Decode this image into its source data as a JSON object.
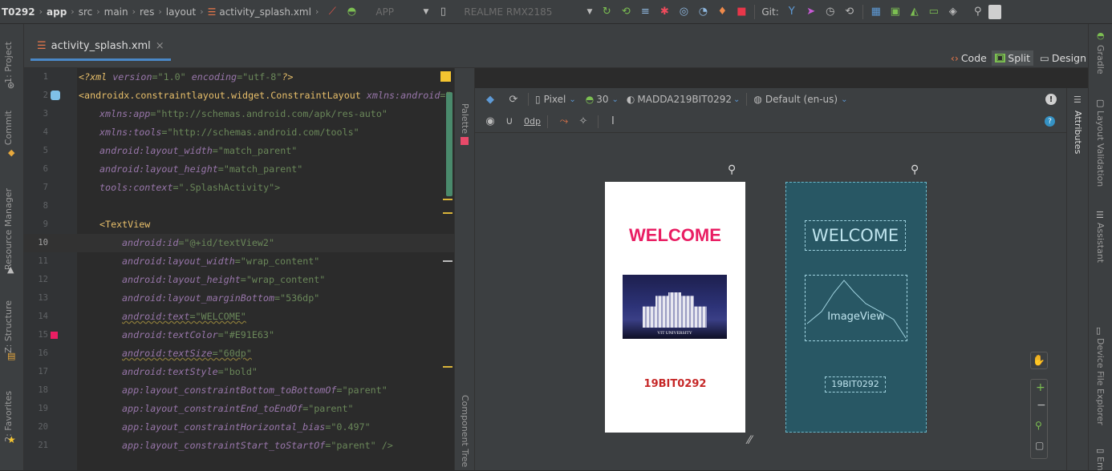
{
  "navbar": {
    "crumbs": [
      "T0292",
      "app",
      "src",
      "main",
      "res",
      "layout",
      "activity_splash.xml"
    ],
    "run_config": "APP",
    "device": "REALME RMX2185",
    "git_label": "Git:"
  },
  "left_tools": [
    "1: Project",
    "Commit",
    "Resource Manager",
    "Z: Structure",
    "2: Favorites"
  ],
  "right_tools": [
    "Gradle",
    "Layout Validation",
    "Assistant",
    "Device File Explorer",
    "Em"
  ],
  "tab": {
    "label": "activity_splash.xml",
    "close": "×"
  },
  "view_modes": {
    "code": "Code",
    "split": "Split",
    "design": "Design"
  },
  "palette_label": "Palette",
  "component_tree_label": "Component Tree",
  "attributes_label": "Attributes",
  "design_toolbar": {
    "device": "Pixel",
    "api": "30",
    "theme": "MADDA219BIT0292",
    "locale": "Default (en-us)",
    "margin": "0dp"
  },
  "preview": {
    "welcome": "WELCOME",
    "image_caption": "VIT UNIVERSITY",
    "reg_no": "19BIT0292",
    "welcome_color": "#E91E63",
    "reg_color": "#C62828"
  },
  "blueprint": {
    "welcome": "WELCOME",
    "image": "ImageView",
    "reg_no": "19BIT0292"
  },
  "code": {
    "line_numbers": [
      "1",
      "2",
      "3",
      "4",
      "5",
      "6",
      "7",
      "8",
      "9",
      "10",
      "11",
      "12",
      "13",
      "14",
      "15",
      "16",
      "17",
      "18",
      "19",
      "20",
      "21"
    ],
    "l1": {
      "pi": "<?",
      "kw": "xml",
      "a1": " version",
      "v1": "=\"1.0\"",
      "a2": " encoding",
      "v2": "=\"utf-8\"",
      "end": "?>"
    },
    "l2": {
      "tag": "<androidx.constraintlayout.widget.ConstraintLayout",
      "ns": " xmlns:",
      "an": "android",
      "eq": "=\""
    },
    "l3": {
      "ns": "xmlns:",
      "an": "app",
      "val": "=\"http://schemas.android.com/apk/res-auto\""
    },
    "l4": {
      "ns": "xmlns:",
      "an": "tools",
      "val": "=\"http://schemas.android.com/tools\""
    },
    "l5": {
      "ns": "android:",
      "an": "layout_width",
      "val": "=\"match_parent\""
    },
    "l6": {
      "ns": "android:",
      "an": "layout_height",
      "val": "=\"match_parent\""
    },
    "l7": {
      "ns": "tools:",
      "an": "context",
      "val": "=\".SplashActivity\">"
    },
    "l9": {
      "tag": "<TextView"
    },
    "l10": {
      "ns": "android:",
      "an": "id",
      "val": "=\"@+id/textView2\""
    },
    "l11": {
      "ns": "android:",
      "an": "layout_width",
      "val": "=\"wrap_content\""
    },
    "l12": {
      "ns": "android:",
      "an": "layout_height",
      "val": "=\"wrap_content\""
    },
    "l13": {
      "ns": "android:",
      "an": "layout_marginBottom",
      "val": "=\"536dp\""
    },
    "l14": {
      "ns": "android:",
      "an": "text",
      "val": "=\"WELCOME\""
    },
    "l15": {
      "ns": "android:",
      "an": "textColor",
      "val": "=\"#E91E63\""
    },
    "l16": {
      "ns": "android:",
      "an": "textSize",
      "val": "=\"60dp\""
    },
    "l17": {
      "ns": "android:",
      "an": "textStyle",
      "val": "=\"bold\""
    },
    "l18": {
      "ns": "app:",
      "an": "layout_constraintBottom_toBottomOf",
      "val": "=\"parent\""
    },
    "l19": {
      "ns": "app:",
      "an": "layout_constraintEnd_toEndOf",
      "val": "=\"parent\""
    },
    "l20": {
      "ns": "app:",
      "an": "layout_constraintHorizontal_bias",
      "val": "=\"0.497\""
    },
    "l21": {
      "ns": "app:",
      "an": "layout_constraintStart_toStartOf",
      "val": "=\"parent\" />"
    }
  }
}
